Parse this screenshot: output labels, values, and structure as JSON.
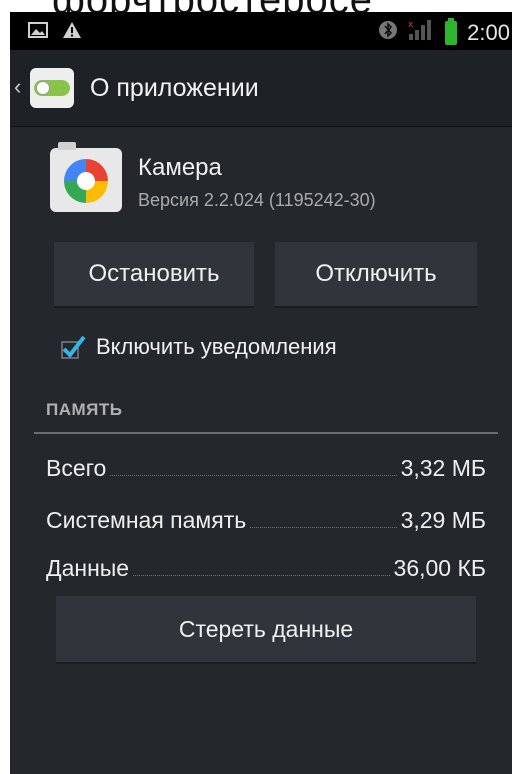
{
  "top_crop_text": "форчтростеросе",
  "status_bar": {
    "time": "2:00",
    "left_icons": [
      "image-icon",
      "warning-icon"
    ],
    "right_icons": [
      "bluetooth-icon",
      "signal-icon",
      "battery-icon"
    ]
  },
  "action_bar": {
    "title": "О приложении",
    "icon": "app-settings-icon"
  },
  "app": {
    "name": "Камера",
    "version": "Версия 2.2.024 (1195242-30)",
    "icon": "camera-icon"
  },
  "buttons": {
    "stop": "Остановить",
    "disable": "Отключить",
    "clear_data": "Стереть данные"
  },
  "notifications": {
    "label": "Включить уведомления",
    "checked": true
  },
  "storage": {
    "header": "ПАМЯТЬ",
    "rows": [
      {
        "label": "Всего",
        "value": "3,32 МБ"
      },
      {
        "label": "Системная память",
        "value": "3,29 МБ"
      },
      {
        "label": "Данные",
        "value": "36,00 КБ"
      }
    ]
  },
  "colors": {
    "accent": "#33b5e5",
    "background": "#24282d",
    "button": "#30353b",
    "battery": "#2fb42f"
  }
}
